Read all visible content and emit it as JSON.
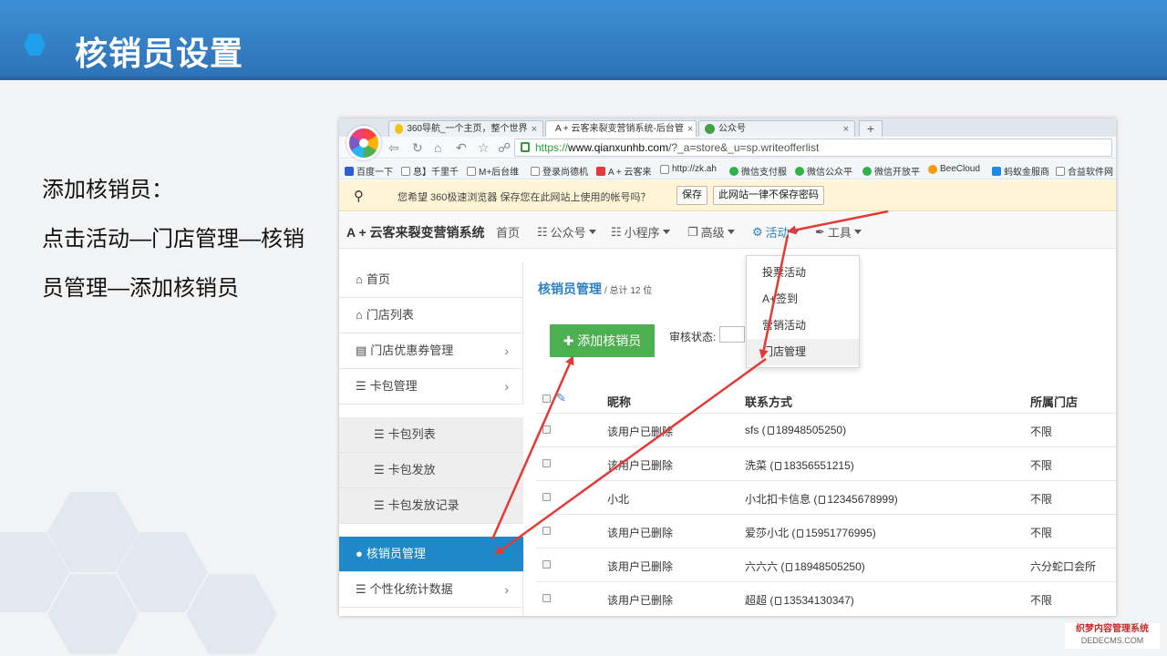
{
  "slide": {
    "title": "核销员设置",
    "instructions": [
      "添加核销员：",
      "点击活动—门店管理—核销员管理—添加核销员"
    ]
  },
  "browser": {
    "tabs": [
      {
        "label": "360导航_一个主页，整个世界",
        "active": false,
        "fav_color": "#f1c40f"
      },
      {
        "label": "A + 云客来裂变营销系统-后台管",
        "active": true,
        "fav_color": "#e53935"
      },
      {
        "label": "公众号",
        "active": false,
        "fav_color": "#43a047"
      }
    ],
    "new_tab": "+",
    "close": "×",
    "url_scheme": "https://",
    "url_host": "www.qianxunhb.com",
    "url_path": "/?_a=store&_u=sp.writeofferlist",
    "bookmarks": [
      {
        "label": "百度一下",
        "color": "#2e5bd6"
      },
      {
        "label": "息】千里千",
        "color": "#888888"
      },
      {
        "label": "M+后台维",
        "color": "#888888"
      },
      {
        "label": "登录尚德机",
        "color": "#888888"
      },
      {
        "label": "A + 云客来",
        "color": "#e53935"
      },
      {
        "label": "http://zk.ah",
        "color": "#888888"
      },
      {
        "label": "微信支付服",
        "color": "#2fb24a"
      },
      {
        "label": "微信公众平",
        "color": "#2fb24a"
      },
      {
        "label": "微信开放平",
        "color": "#2fb24a"
      },
      {
        "label": "BeeCloud",
        "color": "#f39c12"
      },
      {
        "label": "蚂蚁金服商",
        "color": "#1e88e5"
      },
      {
        "label": "合益软件网",
        "color": "#888888"
      }
    ],
    "password_bar": {
      "message": "您希望 360极速浏览器 保存您在此网站上使用的帐号吗？",
      "save": "保存",
      "never": "此网站一律不保存密码"
    }
  },
  "app": {
    "brand": "A + 云客来裂变营销系统",
    "nav": [
      {
        "label": "首页",
        "icon": "",
        "caret": false,
        "active": false
      },
      {
        "label": "公众号",
        "icon": "sitemap-icon",
        "caret": true,
        "active": false
      },
      {
        "label": "小程序",
        "icon": "sitemap-icon",
        "caret": true,
        "active": false
      },
      {
        "label": "高级",
        "icon": "cube-icon",
        "caret": true,
        "active": false
      },
      {
        "label": "活动",
        "icon": "gear-icon",
        "caret": true,
        "active": true
      },
      {
        "label": "工具",
        "icon": "wrench-icon",
        "caret": true,
        "active": false
      }
    ],
    "dropdown": [
      "投票活动",
      "A+签到",
      "营销活动",
      "门店管理"
    ],
    "sidebar": [
      {
        "label": "首页",
        "icon": "home-icon",
        "type": "item"
      },
      {
        "label": "门店列表",
        "icon": "home-icon",
        "type": "item"
      },
      {
        "label": "门店优惠券管理",
        "icon": "ticket-icon",
        "type": "item",
        "chevron": true
      },
      {
        "label": "卡包管理",
        "icon": "list-icon",
        "type": "item",
        "chevron": true
      },
      {
        "label": "卡包列表",
        "icon": "list-icon",
        "type": "sub"
      },
      {
        "label": "卡包发放",
        "icon": "list-icon",
        "type": "sub"
      },
      {
        "label": "卡包发放记录",
        "icon": "list-icon",
        "type": "sub"
      },
      {
        "label": "核销员管理",
        "icon": "user-icon",
        "type": "active"
      },
      {
        "label": "个性化统计数据",
        "icon": "list-icon",
        "type": "item",
        "chevron": true
      }
    ],
    "content": {
      "title": "核销员管理",
      "count": "/ 总计 12 位",
      "add_button": "添加核销员",
      "filter_label": "审核状态:"
    },
    "table": {
      "headers": [
        "昵称",
        "联系方式",
        "所属门店"
      ],
      "rows": [
        {
          "nick": "该用户已删除",
          "contact_name": "sfs",
          "phone": "18948505250",
          "store": "不限"
        },
        {
          "nick": "该用户已删除",
          "contact_name": "洗菜",
          "phone": "18356551215",
          "store": "不限"
        },
        {
          "nick": "小北",
          "contact_name": "小北扣卡信息",
          "phone": "12345678999",
          "store": "不限"
        },
        {
          "nick": "该用户已删除",
          "contact_name": "爱莎小北",
          "phone": "15951776995",
          "store": "不限"
        },
        {
          "nick": "该用户已删除",
          "contact_name": "六六六",
          "phone": "18948505250",
          "store": "六分蛇口会所"
        },
        {
          "nick": "该用户已删除",
          "contact_name": "超超",
          "phone": "13534130347",
          "store": "不限"
        }
      ]
    }
  },
  "watermark": {
    "line1": "织梦内容管理系统",
    "line2": "DEDECMS.COM"
  },
  "colors": {
    "accent": "#2c7fc4",
    "header": "#2e73b8",
    "add_button": "#4caf50",
    "arrow": "#e53935",
    "sidebar_active": "#1e88c9"
  }
}
